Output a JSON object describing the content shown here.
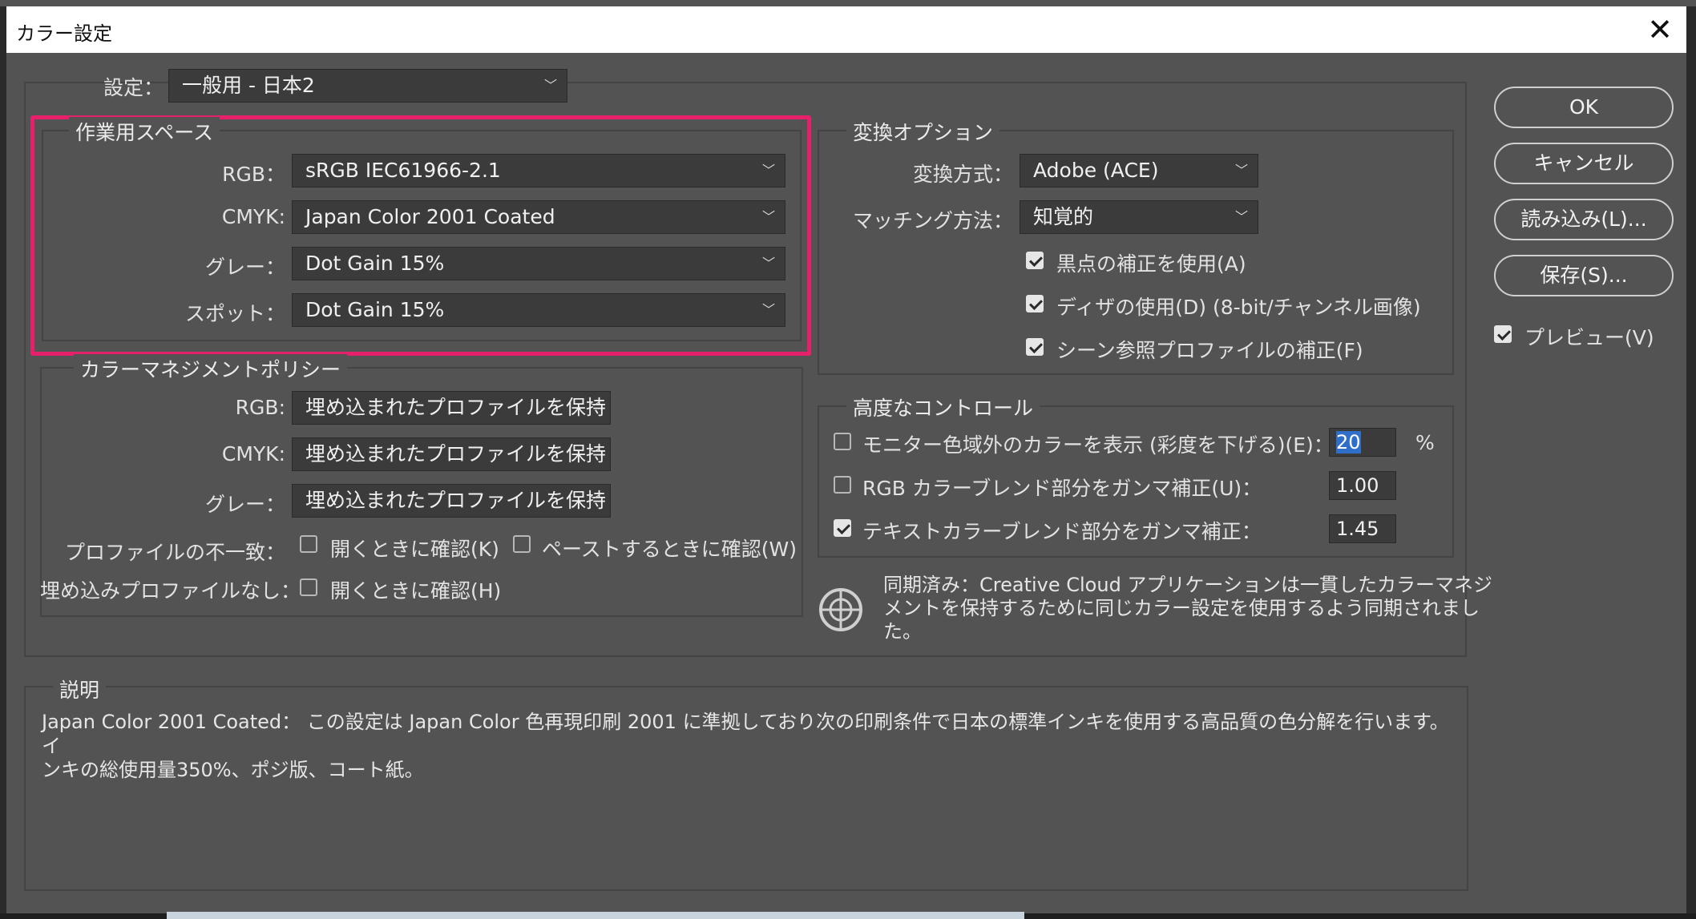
{
  "window": {
    "title": "カラー設定",
    "close_icon": "close-icon"
  },
  "settings": {
    "label": "設定：",
    "value": "一般用 - 日本2"
  },
  "working_spaces": {
    "legend": "作業用スペース",
    "rgb_label": "RGB：",
    "rgb_value": "sRGB IEC61966-2.1",
    "cmyk_label": "CMYK:",
    "cmyk_value": "Japan Color 2001 Coated",
    "gray_label": "グレー：",
    "gray_value": "Dot Gain 15%",
    "spot_label": "スポット：",
    "spot_value": "Dot Gain 15%"
  },
  "policies": {
    "legend": "カラーマネジメントポリシー",
    "rgb_label": "RGB:",
    "rgb_value": "埋め込まれたプロファイルを保持",
    "cmyk_label": "CMYK:",
    "cmyk_value": "埋め込まれたプロファイルを保持",
    "gray_label": "グレー：",
    "gray_value": "埋め込まれたプロファイルを保持",
    "mismatch_label": "プロファイルの不一致：",
    "mismatch_open": "開くときに確認(K)",
    "mismatch_paste": "ペーストするときに確認(W)",
    "missing_label": "埋め込みプロファイルなし：",
    "missing_open": "開くときに確認(H)"
  },
  "conversion": {
    "legend": "変換オプション",
    "engine_label": "変換方式：",
    "engine_value": "Adobe (ACE)",
    "intent_label": "マッチング方法：",
    "intent_value": "知覚的",
    "bpc": "黒点の補正を使用(A)",
    "dither": "ディザの使用(D) (8-bit/チャンネル画像)",
    "scene": "シーン参照プロファイルの補正(F)"
  },
  "advanced": {
    "legend": "高度なコントロール",
    "desaturate": "モニター色域外のカラーを表示 (彩度を下げる)(E)：",
    "desaturate_value": "20",
    "percent": "%",
    "blend_rgb": "RGB カラーブレンド部分をガンマ補正(U)：",
    "blend_rgb_value": "1.00",
    "blend_text": "テキストカラーブレンド部分をガンマ補正：",
    "blend_text_value": "1.45"
  },
  "sync": {
    "line1": "同期済み：Creative Cloud アプリケーションは一貫したカラーマネジ",
    "line2": "メントを保持するために同じカラー設定を使用するよう同期されまし",
    "line3": "た。"
  },
  "description": {
    "legend": "説明",
    "line1": "Japan Color 2001 Coated： この設定は Japan Color 色再現印刷 2001 に準拠しており次の印刷条件で日本の標準インキを使用する高品質の色分解を行います。イ",
    "line2": "ンキの総使用量350%、ポジ版、コート紙。"
  },
  "buttons": {
    "ok": "OK",
    "cancel": "キャンセル",
    "load": "読み込み(L)...",
    "save": "保存(S)...",
    "preview": "プレビュー(V)"
  },
  "colors": {
    "highlight": "#e6206a",
    "background": "#535353",
    "selection": "#2f6fc9"
  }
}
